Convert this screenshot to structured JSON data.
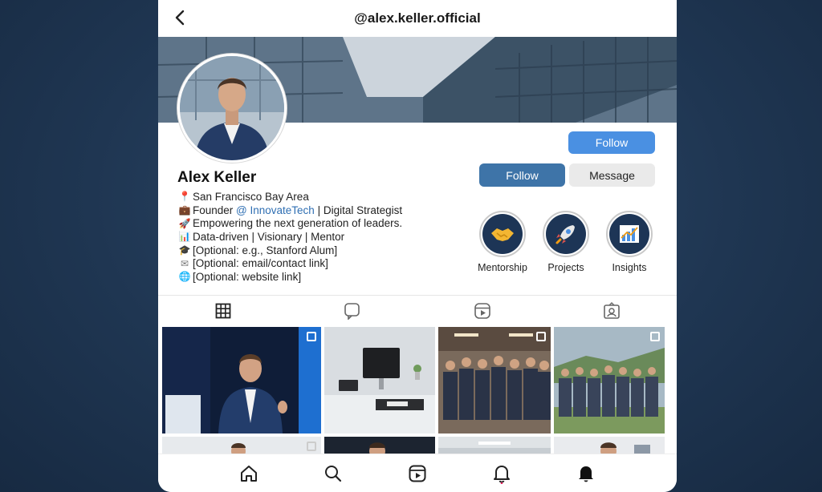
{
  "header": {
    "username": "@alex.keller.official"
  },
  "profile": {
    "name": "Alex Keller",
    "bio": [
      {
        "icon": "📍",
        "icon_name": "pin-icon",
        "text": "San Francisco Bay Area"
      },
      {
        "icon": "💼",
        "icon_name": "briefcase-icon",
        "prefix": "Founder ",
        "mention": "@ InnovateTech",
        "suffix": " | Digital Strategist"
      },
      {
        "icon": "🚀",
        "icon_name": "rocket-icon",
        "text": "Empowering the next generation of leaders."
      },
      {
        "icon": "📊",
        "icon_name": "chart-icon",
        "text": "Data-driven | Visionary | Mentor"
      },
      {
        "icon": "🎓",
        "icon_name": "graduation-cap-icon",
        "text": "[Optional: e.g., Stanford Alum]"
      },
      {
        "icon": "✉",
        "icon_name": "envelope-icon",
        "text": "[Optional: email/contact link]"
      },
      {
        "icon": "🌐",
        "icon_name": "globe-icon",
        "text": "[Optional: website link]"
      }
    ]
  },
  "actions": {
    "follow_top_label": "Follow",
    "follow_label": "Follow",
    "message_label": "Message"
  },
  "highlights": [
    {
      "label": "Mentorship",
      "icon": "handshake-icon"
    },
    {
      "label": "Projects",
      "icon": "rocket-icon"
    },
    {
      "label": "Insights",
      "icon": "chart-icon"
    }
  ],
  "tabs": [
    {
      "icon": "grid-icon",
      "active": true
    },
    {
      "icon": "chat-bubble-icon",
      "active": false
    },
    {
      "icon": "reels-icon",
      "active": false
    },
    {
      "icon": "tagged-icon",
      "active": false
    }
  ],
  "grid": {
    "posts": [
      {
        "subject": "keynote-speaking",
        "multi": true
      },
      {
        "subject": "desk-workspace",
        "multi": false
      },
      {
        "subject": "team-photo-office",
        "multi": true
      },
      {
        "subject": "team-photo-outdoor",
        "multi": true
      },
      {
        "subject": "portrait",
        "multi": true
      },
      {
        "subject": "portrait-dark",
        "multi": false
      },
      {
        "subject": "office-lights",
        "multi": false
      },
      {
        "subject": "portrait-group",
        "multi": false
      }
    ]
  },
  "bottom_nav": [
    {
      "icon": "home-icon"
    },
    {
      "icon": "search-icon"
    },
    {
      "icon": "reels-icon"
    },
    {
      "icon": "notification-bell-icon"
    },
    {
      "icon": "activity-bell-filled-icon"
    }
  ],
  "colors": {
    "follow_primary": "#4a90e2",
    "follow_dark": "#3e74a8",
    "mention": "#2f6fb3",
    "highlight_bg": "#1d3556"
  }
}
